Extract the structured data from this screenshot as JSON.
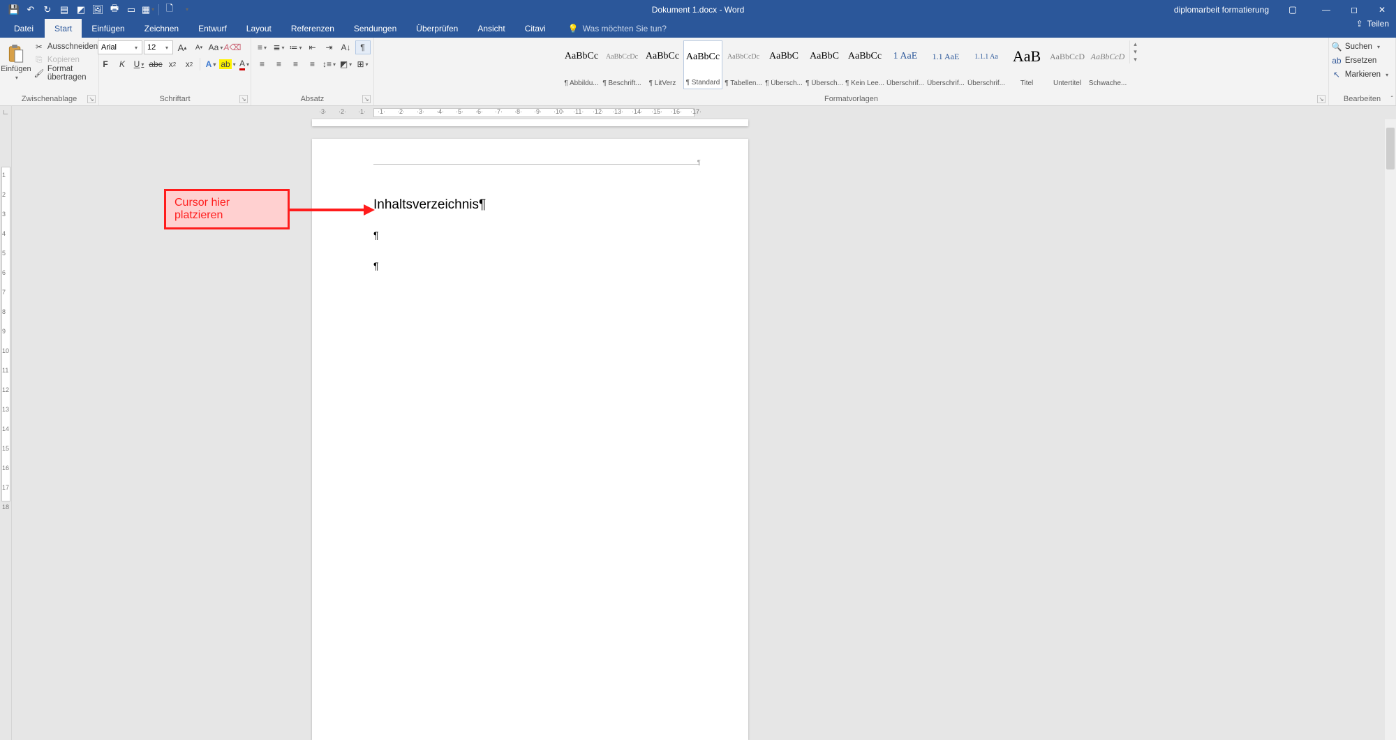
{
  "titlebar": {
    "doc_title": "Dokument 1.docx - Word",
    "account": "diplomarbeit formatierung"
  },
  "tabs": {
    "file": "Datei",
    "items": [
      "Start",
      "Einfügen",
      "Zeichnen",
      "Entwurf",
      "Layout",
      "Referenzen",
      "Sendungen",
      "Überprüfen",
      "Ansicht",
      "Citavi"
    ],
    "tellme_placeholder": "Was möchten Sie tun?",
    "share": "Teilen"
  },
  "clipboard": {
    "paste": "Einfügen",
    "cut": "Ausschneiden",
    "copy": "Kopieren",
    "format_painter": "Format übertragen",
    "group_label": "Zwischenablage"
  },
  "font": {
    "name": "Arial",
    "size": "12",
    "group_label": "Schriftart"
  },
  "paragraph": {
    "group_label": "Absatz"
  },
  "styles": {
    "group_label": "Formatvorlagen",
    "items": [
      {
        "preview": "AaBbCc",
        "name": "¶ Abbildu...",
        "cls": ""
      },
      {
        "preview": "AaBbCcDc",
        "name": "¶ Beschrift...",
        "cls": "light"
      },
      {
        "preview": "AaBbCc",
        "name": "¶ LitVerz",
        "cls": ""
      },
      {
        "preview": "AaBbCc",
        "name": "¶ Standard",
        "cls": "",
        "selected": true
      },
      {
        "preview": "AaBbCcDc",
        "name": "¶ Tabellen...",
        "cls": "light"
      },
      {
        "preview": "AaBbC",
        "name": "¶ Übersch...",
        "cls": ""
      },
      {
        "preview": "AaBbC",
        "name": "¶ Übersch...",
        "cls": ""
      },
      {
        "preview": "AaBbCc",
        "name": "¶ Kein Lee...",
        "cls": ""
      },
      {
        "preview": "1 AaE",
        "name": "Überschrif...",
        "cls": "blue"
      },
      {
        "preview": "1.1 AaE",
        "name": "Überschrif...",
        "cls": "blue"
      },
      {
        "preview": "1.1.1 Aa",
        "name": "Überschrif...",
        "cls": "blue"
      },
      {
        "preview": "AaB",
        "name": "Titel",
        "cls": ""
      },
      {
        "preview": "AaBbCcD",
        "name": "Untertitel",
        "cls": "light"
      },
      {
        "preview": "AaBbCcD",
        "name": "Schwache...",
        "cls": "light italic"
      }
    ]
  },
  "editing": {
    "find": "Suchen",
    "replace": "Ersetzen",
    "select": "Markieren",
    "group_label": "Bearbeiten"
  },
  "document": {
    "heading": "Inhaltsverzeichnis¶",
    "pilcrow1": "¶",
    "pilcrow2": "¶"
  },
  "annotation": {
    "label": "Cursor hier platzieren"
  },
  "ruler": {
    "h_numbers": [
      "3",
      "2",
      "1",
      "1",
      "2",
      "3",
      "4",
      "5",
      "6",
      "7",
      "8",
      "9",
      "10",
      "11",
      "12",
      "13",
      "14",
      "15",
      "16",
      "17"
    ],
    "v_numbers": [
      "1",
      "2",
      "3",
      "4",
      "5",
      "6",
      "7",
      "8",
      "9",
      "10",
      "11",
      "12",
      "13",
      "14",
      "15",
      "16",
      "17",
      "18"
    ]
  }
}
